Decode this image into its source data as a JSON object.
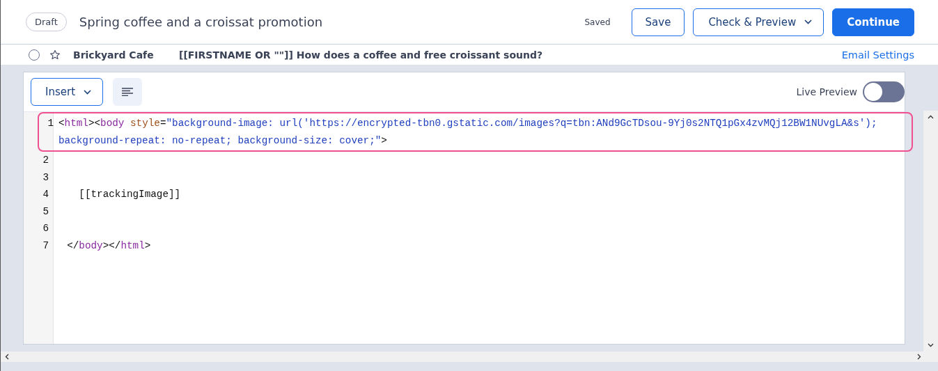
{
  "header": {
    "status_badge": "Draft",
    "title": "Spring coffee and a croissat promotion",
    "save_status": "Saved",
    "buttons": [
      {
        "label": "Save",
        "kind": "outline"
      },
      {
        "label": "Check & Preview",
        "kind": "dropdown"
      },
      {
        "label": "Continue",
        "kind": "primary"
      }
    ]
  },
  "email_row": {
    "selected": false,
    "starred": false,
    "sender": "Brickyard Cafe",
    "subject": "[[FIRSTNAME OR \"\"]] How does a coffee and free croissant sound?",
    "settings_link": "Email Settings"
  },
  "toolbar": {
    "insert_button": "Insert",
    "live_preview": {
      "label": "Live Preview",
      "on": false
    }
  },
  "code_lines": [
    {
      "number": "1",
      "highlighted": true,
      "tokens": [
        {
          "kind": "punct",
          "text": "<"
        },
        {
          "kind": "tag",
          "text": "html"
        },
        {
          "kind": "punct",
          "text": "><"
        },
        {
          "kind": "tag",
          "text": "body"
        },
        {
          "kind": "attr",
          "text": " style"
        },
        {
          "kind": "punct",
          "text": "="
        },
        {
          "kind": "str",
          "text": "\"background-image: url('https://encrypted-tbn0.gstatic.com/images?q=tbn:ANd9GcTDsou-9Yj0s2NTQ1pGx4zvMQj12BW1NUvgLA&s'); background-repeat: no-repeat; background-size: cover;\""
        },
        {
          "kind": "punct",
          "text": ">"
        }
      ]
    },
    {
      "number": "2",
      "highlighted": false
    },
    {
      "number": "3",
      "highlighted": false
    },
    {
      "number": "4",
      "highlighted": false,
      "tokens": [
        {
          "kind": "punct",
          "text": "    [[trackingImage]]"
        }
      ]
    },
    {
      "number": "5",
      "highlighted": false
    },
    {
      "number": "6",
      "highlighted": false
    },
    {
      "number": "7",
      "highlighted": false,
      "tokens": [
        {
          "kind": "punct",
          "text": "  </"
        },
        {
          "kind": "tag",
          "text": "body"
        },
        {
          "kind": "punct",
          "text": "></"
        },
        {
          "kind": "tag",
          "text": "html"
        },
        {
          "kind": "punct",
          "text": ">"
        }
      ]
    }
  ]
}
